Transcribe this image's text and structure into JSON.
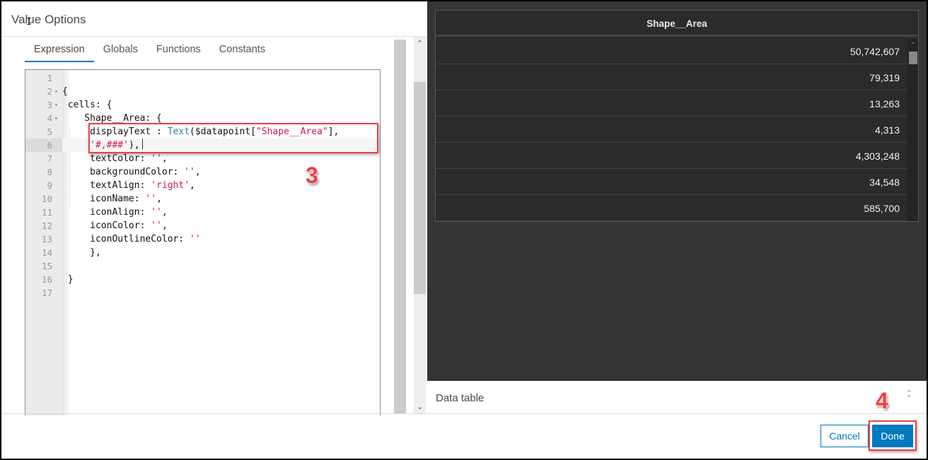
{
  "dialog": {
    "title": "Value Options"
  },
  "tabs": [
    {
      "label": "Expression",
      "active": true
    },
    {
      "label": "Globals",
      "active": false
    },
    {
      "label": "Functions",
      "active": false
    },
    {
      "label": "Constants",
      "active": false
    }
  ],
  "editor": {
    "lines": [
      {
        "n": "1",
        "text": ""
      },
      {
        "n": "2",
        "text": "{"
      },
      {
        "n": "3",
        "text": " cells: {"
      },
      {
        "n": "4",
        "text": "    Shape__Area: {"
      },
      {
        "n": "5",
        "pre": "     displayText : ",
        "fn": "Text",
        "mid": "($datapoint[",
        "str": "\"Shape__Area\"",
        "post": "],"
      },
      {
        "n": "6",
        "pre": "     ",
        "str": "'#,###'",
        "post": "),"
      },
      {
        "n": "7",
        "pre": "     textColor: ",
        "str": "''",
        "post": ","
      },
      {
        "n": "8",
        "pre": "     backgroundColor: ",
        "str": "''",
        "post": ","
      },
      {
        "n": "9",
        "pre": "     textAlign: ",
        "str": "'right'",
        "post": ","
      },
      {
        "n": "10",
        "pre": "     iconName: ",
        "str": "''",
        "post": ","
      },
      {
        "n": "11",
        "pre": "     iconAlign: ",
        "str": "''",
        "post": ","
      },
      {
        "n": "12",
        "pre": "     iconColor: ",
        "str": "''",
        "post": ","
      },
      {
        "n": "13",
        "pre": "     iconOutlineColor: ",
        "str": "''",
        "post": ""
      },
      {
        "n": "14",
        "text": "     },"
      },
      {
        "n": "15",
        "text": ""
      },
      {
        "n": "16",
        "text": " }"
      },
      {
        "n": "17",
        "text": ""
      }
    ],
    "fold_icon": "fold-arrow-icon"
  },
  "annotations": {
    "step3": "3",
    "step4": "4"
  },
  "preview_table": {
    "header": "Shape__Area",
    "rows": [
      "50,742,607",
      "79,319",
      "13,263",
      "4,313",
      "4,303,248",
      "34,548",
      "585,700"
    ]
  },
  "data_table_bar": {
    "label": "Data table",
    "toggle_icon": "double-chevron-up-icon"
  },
  "footer": {
    "cancel_label": "Cancel",
    "done_label": "Done"
  },
  "colors": {
    "accent": "#0079c1",
    "annotation": "#ef3e42",
    "preview_bg": "#353535"
  }
}
